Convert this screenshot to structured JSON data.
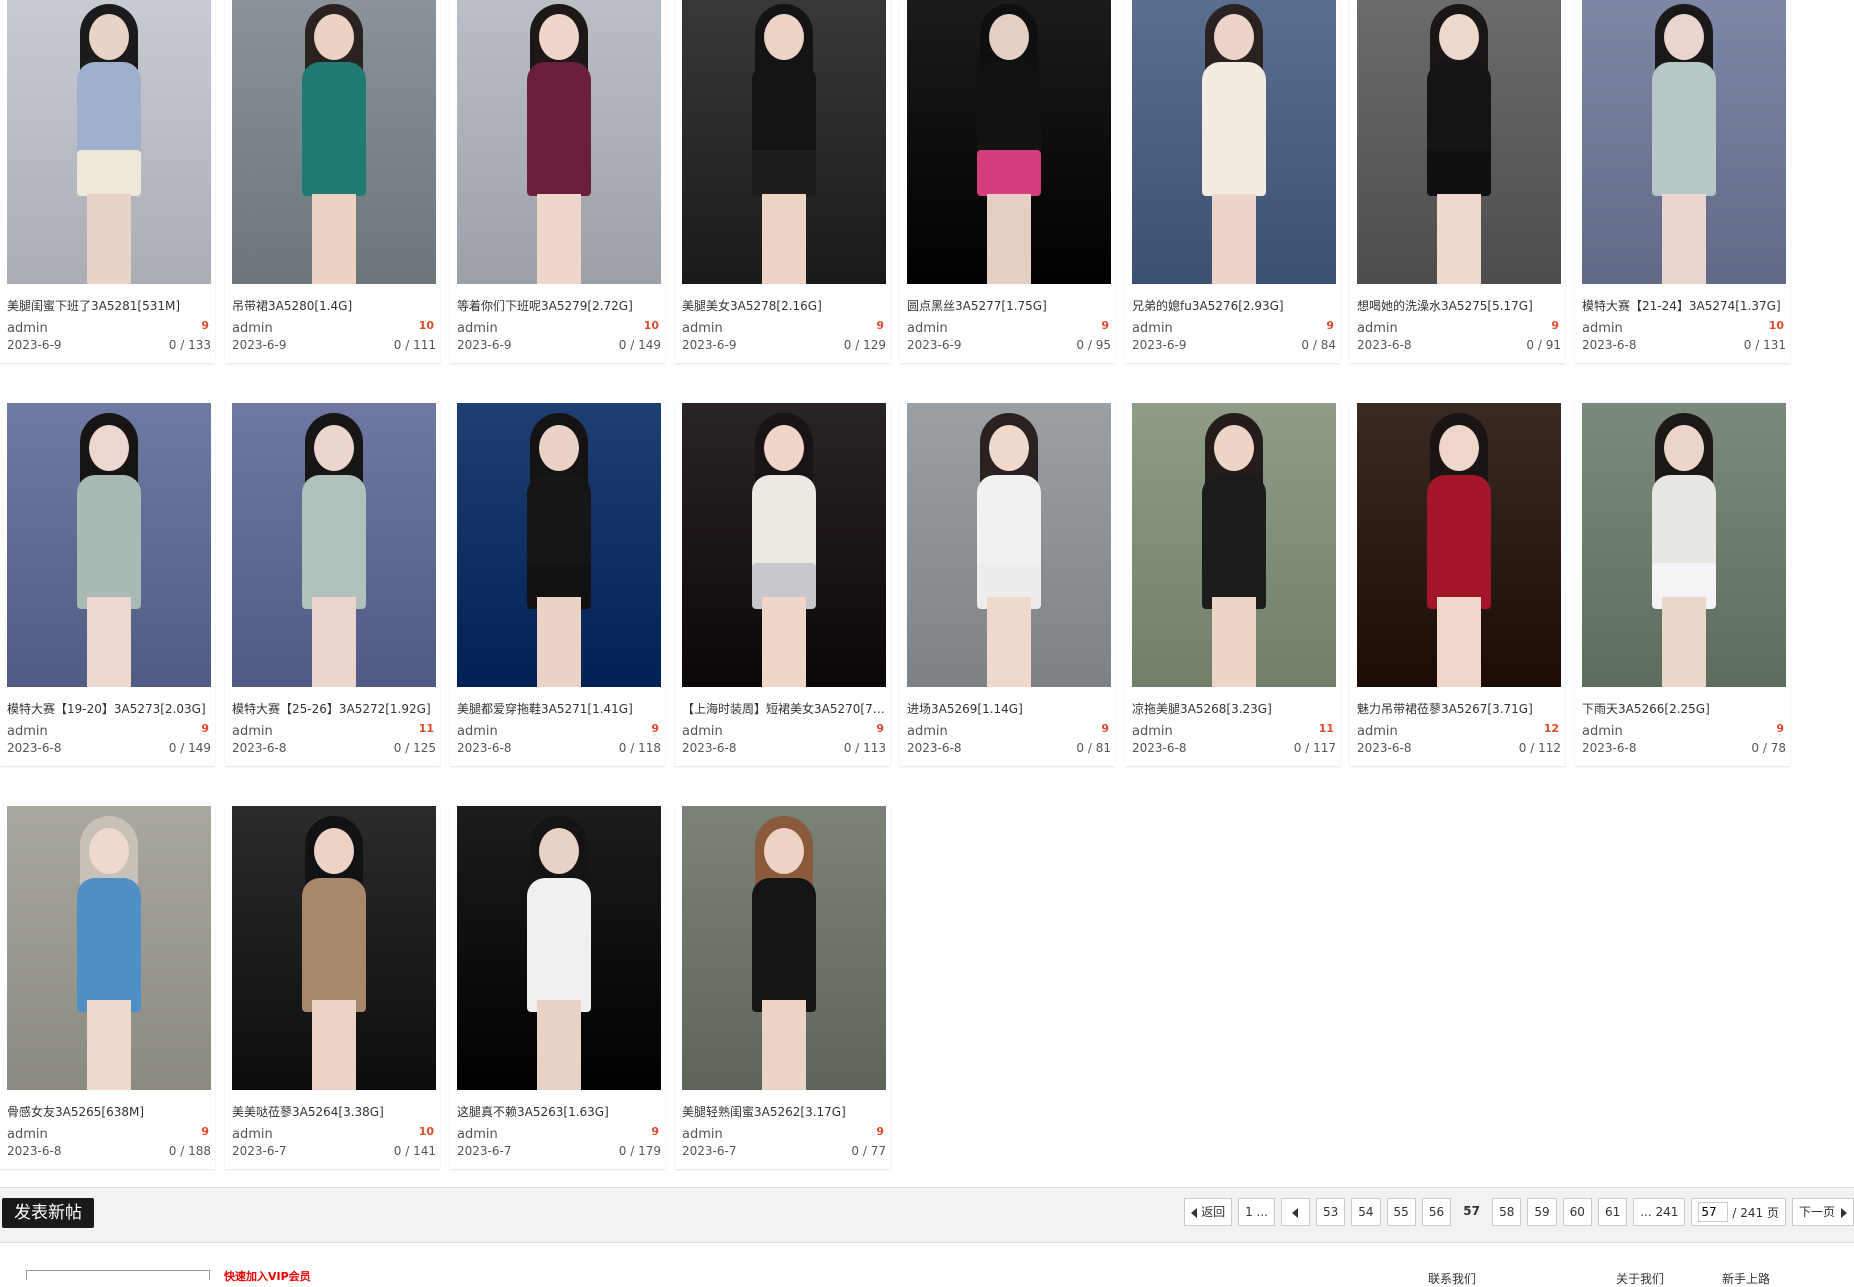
{
  "threads": [
    {
      "title": "美腿闺蜜下班了3A5281[531M]",
      "author": "admin",
      "replies": "9",
      "date": "2023-6-9",
      "stats": "0 / 133",
      "colors": {
        "bg": "#c8ccd2",
        "hair": "#1b1a1c",
        "skin": "#e9d3c6",
        "top": "#9fb0cf",
        "bottom": "#efe7da"
      }
    },
    {
      "title": "吊带裙3A5280[1.4G]",
      "author": "admin",
      "replies": "10",
      "date": "2023-6-9",
      "stats": "0 / 111",
      "colors": {
        "bg": "#8a9498",
        "hair": "#2a2220",
        "skin": "#ecd2c2",
        "top": "#1f7b74",
        "bottom": "#1f7b74"
      }
    },
    {
      "title": "等着你们下班呢3A5279[2.72G]",
      "author": "admin",
      "replies": "10",
      "date": "2023-6-9",
      "stats": "0 / 149",
      "colors": {
        "bg": "#b9bfc4",
        "hair": "#1d1717",
        "skin": "#efd6ca",
        "top": "#6a1f3d",
        "bottom": "#6a1f3d"
      }
    },
    {
      "title": "美腿美女3A5278[2.16G]",
      "author": "admin",
      "replies": "9",
      "date": "2023-6-9",
      "stats": "0 / 129",
      "colors": {
        "bg": "#3a3837",
        "hair": "#151313",
        "skin": "#ecd3c6",
        "top": "#141414",
        "bottom": "#1d1d1f"
      }
    },
    {
      "title": "圆点黑丝3A5277[1.75G]",
      "author": "admin",
      "replies": "9",
      "date": "2023-6-9",
      "stats": "0 / 95",
      "colors": {
        "bg": "#1c1b1c",
        "hair": "#0f0f10",
        "skin": "#e5cfc4",
        "top": "#121212",
        "bottom": "#d23f7c"
      }
    },
    {
      "title": "兄弟的媳fu3A5276[2.93G]",
      "author": "admin",
      "replies": "9",
      "date": "2023-6-9",
      "stats": "0 / 84",
      "colors": {
        "bg": "#5a6f8f",
        "hair": "#2a2220",
        "skin": "#ecd5c8",
        "top": "#f3ece0",
        "bottom": "#f3ece0"
      }
    },
    {
      "title": "想喝她的洗澡水3A5275[5.17G]",
      "author": "admin",
      "replies": "9",
      "date": "2023-6-8",
      "stats": "0 / 91",
      "colors": {
        "bg": "#6c6b6c",
        "hair": "#1a1616",
        "skin": "#efd9cd",
        "top": "#141414",
        "bottom": "#101010"
      }
    },
    {
      "title": "模特大赛【21-24】3A5274[1.37G]",
      "author": "admin",
      "replies": "10",
      "date": "2023-6-8",
      "stats": "0 / 131",
      "colors": {
        "bg": "#7f87a6",
        "hair": "#1b1818",
        "skin": "#ead6cf",
        "top": "#b7c6c6",
        "bottom": "#b7c6c6"
      }
    },
    {
      "title": "模特大赛【19-20】3A5273[2.03G]",
      "author": "admin",
      "replies": "9",
      "date": "2023-6-8",
      "stats": "0 / 149",
      "colors": {
        "bg": "#6f7aa3",
        "hair": "#171414",
        "skin": "#ecd8d0",
        "top": "#a9b9b4",
        "bottom": "#a9b9b4"
      }
    },
    {
      "title": "模特大赛【25-26】3A5272[1.92G]",
      "author": "admin",
      "replies": "11",
      "date": "2023-6-8",
      "stats": "0 / 125",
      "colors": {
        "bg": "#6e78a1",
        "hair": "#181515",
        "skin": "#ead6ce",
        "top": "#b0c1bc",
        "bottom": "#b0c1bc"
      }
    },
    {
      "title": "美腿都爱穿拖鞋3A5271[1.41G]",
      "author": "admin",
      "replies": "9",
      "date": "2023-6-8",
      "stats": "0 / 118",
      "colors": {
        "bg": "#1f3f73",
        "hair": "#141212",
        "skin": "#ead3c6",
        "top": "#161616",
        "bottom": "#111111"
      }
    },
    {
      "title": "【上海时装周】短裙美女3A5270[75...",
      "author": "admin",
      "replies": "9",
      "date": "2023-6-8",
      "stats": "0 / 113",
      "colors": {
        "bg": "#2b2424",
        "hair": "#1a1414",
        "skin": "#f0d6c9",
        "top": "#ece8e2",
        "bottom": "#c8c8cc"
      }
    },
    {
      "title": "进场3A5269[1.14G]",
      "author": "admin",
      "replies": "9",
      "date": "2023-6-8",
      "stats": "0 / 81",
      "colors": {
        "bg": "#9aa0a4",
        "hair": "#2a2120",
        "skin": "#efd8cc",
        "top": "#f1f1f1",
        "bottom": "#ededed"
      }
    },
    {
      "title": "凉拖美腿3A5268[3.23G]",
      "author": "admin",
      "replies": "11",
      "date": "2023-6-8",
      "stats": "0 / 117",
      "colors": {
        "bg": "#8f9c88",
        "hair": "#231c1a",
        "skin": "#ecd4c7",
        "top": "#1c1c1e",
        "bottom": "#1c1c1e"
      }
    },
    {
      "title": "魅力吊带裙莅蓼3A5267[3.71G]",
      "author": "admin",
      "replies": "12",
      "date": "2023-6-8",
      "stats": "0 / 112",
      "colors": {
        "bg": "#3a2a24",
        "hair": "#1a1414",
        "skin": "#f0d7cb",
        "top": "#a3162a",
        "bottom": "#a3162a"
      }
    },
    {
      "title": "下雨天3A5266[2.25G]",
      "author": "admin",
      "replies": "9",
      "date": "2023-6-8",
      "stats": "0 / 78",
      "colors": {
        "bg": "#7c8a7c",
        "hair": "#1d1818",
        "skin": "#ecd6cb",
        "top": "#e9e7e3",
        "bottom": "#f4f4f6"
      }
    },
    {
      "title": "骨感女友3A5265[638M]",
      "author": "admin",
      "replies": "9",
      "date": "2023-6-8",
      "stats": "0 / 188",
      "colors": {
        "bg": "#a9a89f",
        "hair": "#c7c1b7",
        "skin": "#efd8cc",
        "top": "#4f8fc6",
        "bottom": "#4f8fc6"
      }
    },
    {
      "title": "美美哒莅蓼3A5264[3.38G]",
      "author": "admin",
      "replies": "10",
      "date": "2023-6-7",
      "stats": "0 / 141",
      "colors": {
        "bg": "#2b2a2c",
        "hair": "#121113",
        "skin": "#ecd3c6",
        "top": "#a9876a",
        "bottom": "#a9876a"
      }
    },
    {
      "title": "这腿真不赖3A5263[1.63G]",
      "author": "admin",
      "replies": "9",
      "date": "2023-6-7",
      "stats": "0 / 179",
      "colors": {
        "bg": "#1d1c1d",
        "hair": "#151314",
        "skin": "#e8d1c5",
        "top": "#f1f0ee",
        "bottom": "#f1f0ee"
      }
    },
    {
      "title": "美腿轻熟闺蜜3A5262[3.17G]",
      "author": "admin",
      "replies": "9",
      "date": "2023-6-7",
      "stats": "0 / 77",
      "colors": {
        "bg": "#7b8378",
        "hair": "#8a5a3a",
        "skin": "#ecd3c4",
        "top": "#151515",
        "bottom": "#151515"
      }
    }
  ],
  "toolbar": {
    "new_post_label": "发表新帖"
  },
  "pagination": {
    "back_label": "返回",
    "first_label": "1 ...",
    "pages": [
      "53",
      "54",
      "55",
      "56",
      "57",
      "58",
      "59",
      "60",
      "61"
    ],
    "current": "57",
    "last_label": "... 241",
    "jump_value": "57",
    "total_label": "/ 241 页",
    "next_label": "下一页"
  },
  "footer": {
    "vip_notice": "快速加入VIP会员",
    "links": [
      "联系我们",
      "关于我们",
      "新手上路"
    ]
  }
}
